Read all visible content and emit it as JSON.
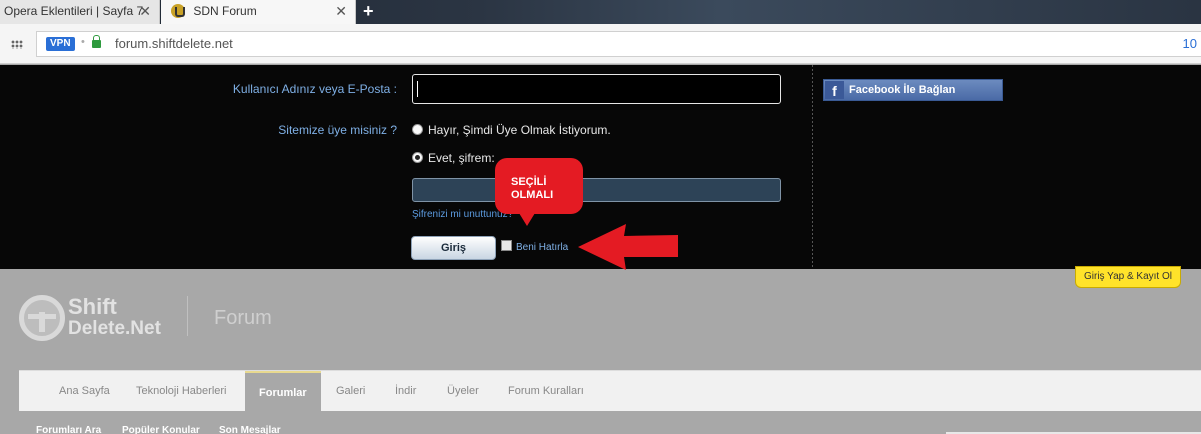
{
  "browser": {
    "tabs": [
      {
        "label": "Opera Eklentileri | Sayfa 7",
        "close": "✕"
      },
      {
        "label": "SDN Forum",
        "close": "✕"
      }
    ],
    "new_tab": "+",
    "vpn_badge": "VPN",
    "url": "forum.shiftdelete.net",
    "zoom": "10"
  },
  "login": {
    "username_label": "Kullanıcı Adınız veya E-Posta :",
    "member_label": "Sitemize üye misiniz ?",
    "option_no": "Hayır, Şimdi Üye Olmak İstiyorum.",
    "option_yes": "Evet, şifrem:",
    "forgot_password": "Şifrenizi mi unuttunuz?",
    "login_button": "Giriş",
    "remember_me": "Beni Hatırla",
    "facebook_button": "Facebook İle Bağlan",
    "facebook_icon": "f"
  },
  "annotation": {
    "callout_text": "SEÇİLİ OLMALI",
    "color": "#e41b23"
  },
  "header": {
    "login_register": "Giriş Yap & Kayıt Ol",
    "logo_line1": "Shift",
    "logo_line2": "Delete.Net",
    "section": "Forum"
  },
  "nav": {
    "items": [
      "Ana Sayfa",
      "Teknoloji Haberleri",
      "Forumlar",
      "Galeri",
      "İndir",
      "Üyeler",
      "Forum Kuralları"
    ],
    "active": "Forumlar"
  },
  "subnav": {
    "items": [
      "Forumları Ara",
      "Popüler Konular",
      "Son Mesajlar"
    ]
  }
}
